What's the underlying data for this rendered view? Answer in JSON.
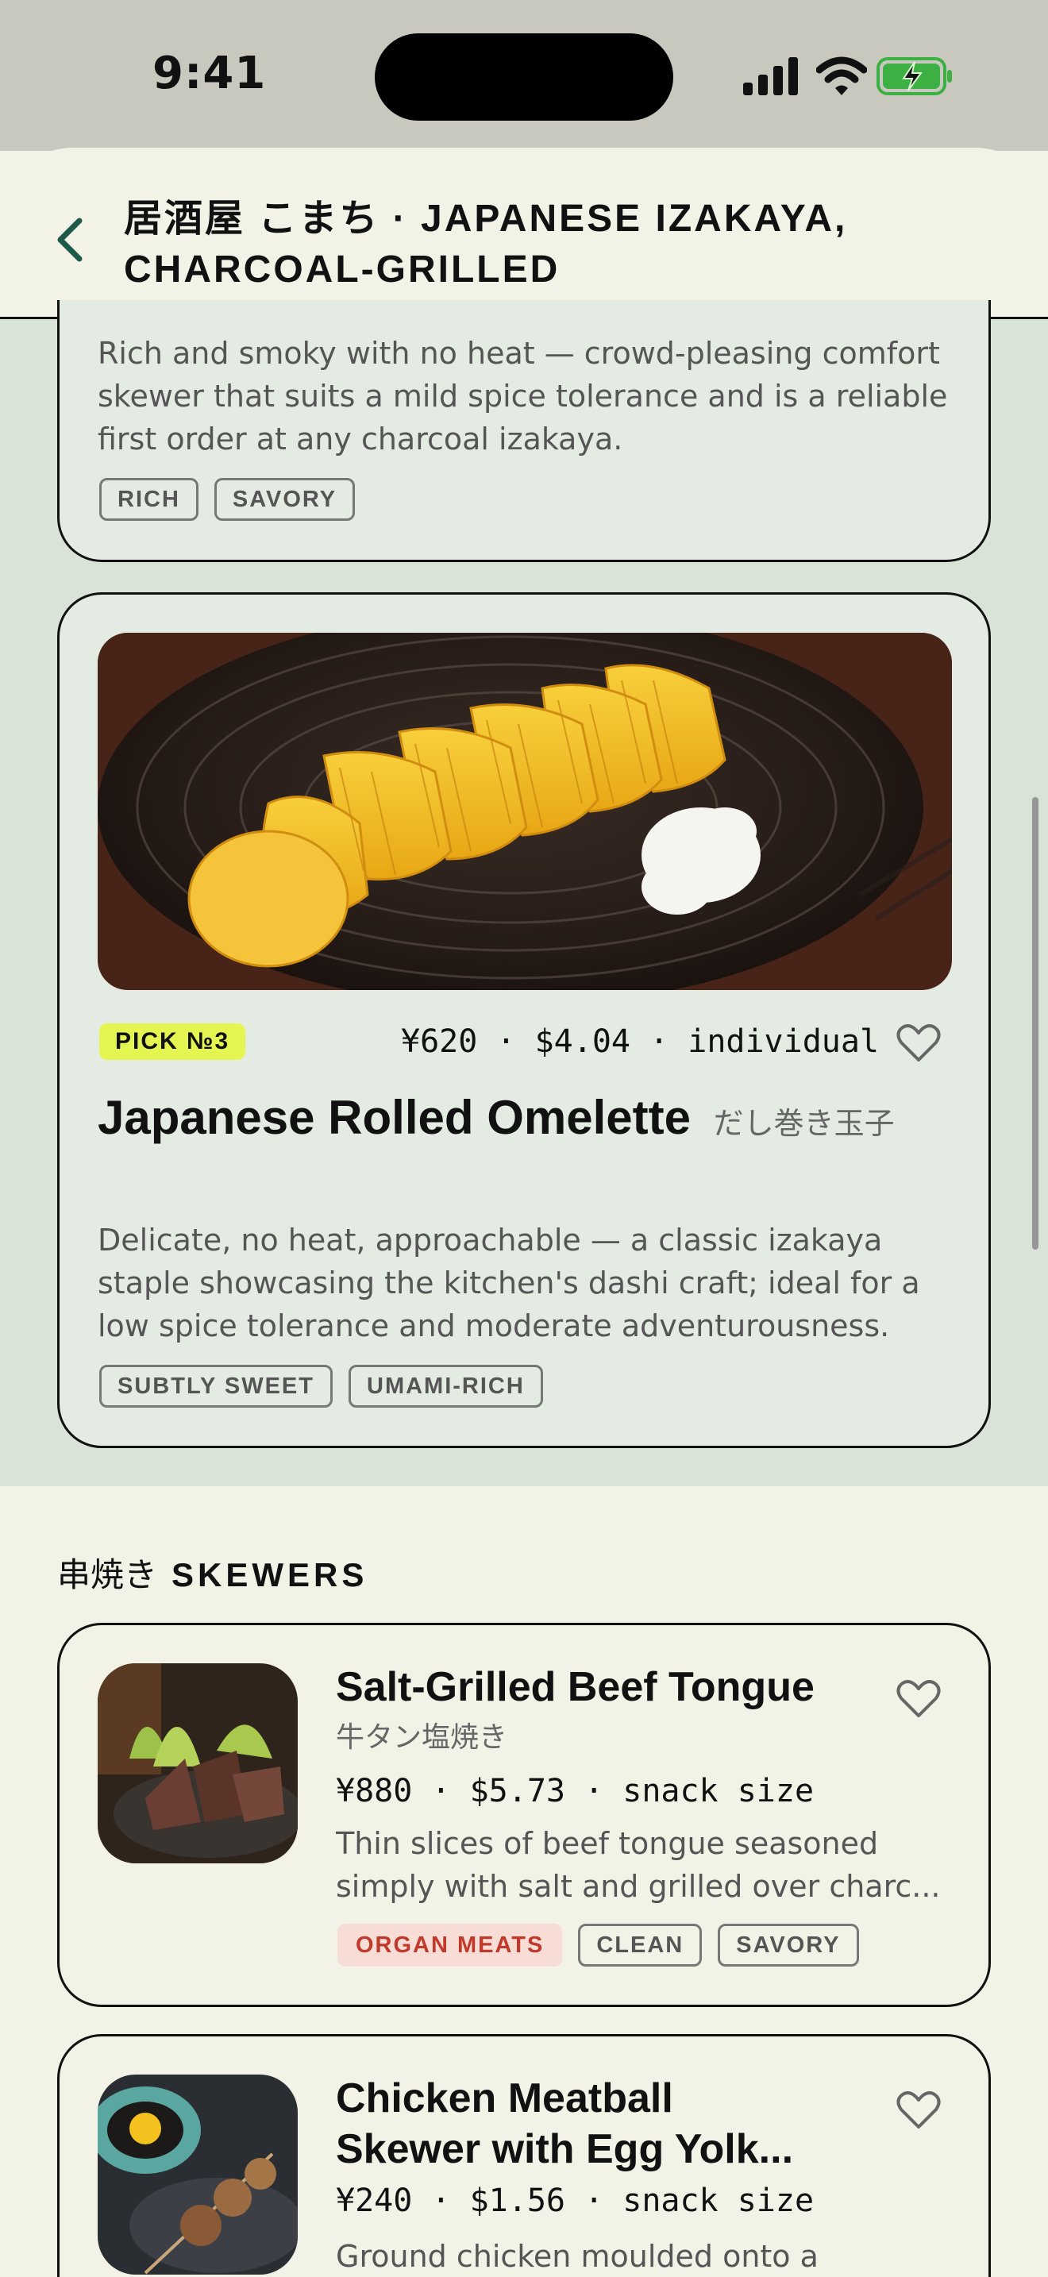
{
  "status": {
    "time": "9:41"
  },
  "header": {
    "title": "居酒屋 こまち · JAPANESE IZAKAYA, CHARCOAL-GRILLED"
  },
  "top_card": {
    "description": "Rich and smoky with no heat — crowd-pleasing comfort skewer that suits a mild spice tolerance and is a reliable first order at any charcoal izakaya.",
    "tags": [
      "RICH",
      "SAVORY"
    ]
  },
  "featured": {
    "pick_label": "PICK №3",
    "price": "¥620 · $4.04 · individual",
    "name": "Japanese Rolled Omelette",
    "name_jp": "だし巻き玉子",
    "description": "Delicate, no heat, approachable — a classic izakaya staple showcasing the kitchen's dashi craft; ideal for a low spice tolerance and moderate adventurousness.",
    "tags": [
      "SUBTLY SWEET",
      "UMAMI-RICH"
    ]
  },
  "section": {
    "title_jp": "串焼き",
    "title_en": "SKEWERS"
  },
  "items": [
    {
      "name": "Salt-Grilled Beef Tongue",
      "name_jp": "牛タン塩焼き",
      "price": "¥880 · $5.73 · snack size",
      "description": "Thin slices of beef tongue seasoned simply with salt and grilled over charc...",
      "tags": [
        "ORGAN MEATS",
        "CLEAN",
        "SAVORY"
      ]
    },
    {
      "name": "Chicken Meatball Skewer with Egg Yolk...",
      "price": "¥240 · $1.56 · snack size",
      "description": "Ground chicken moulded onto a"
    }
  ],
  "colors": {
    "background": "#f3f2e7",
    "featured_bg": "#d9e3d8",
    "pick_badge": "#e4f552",
    "warning_tag": "#c0392b"
  }
}
